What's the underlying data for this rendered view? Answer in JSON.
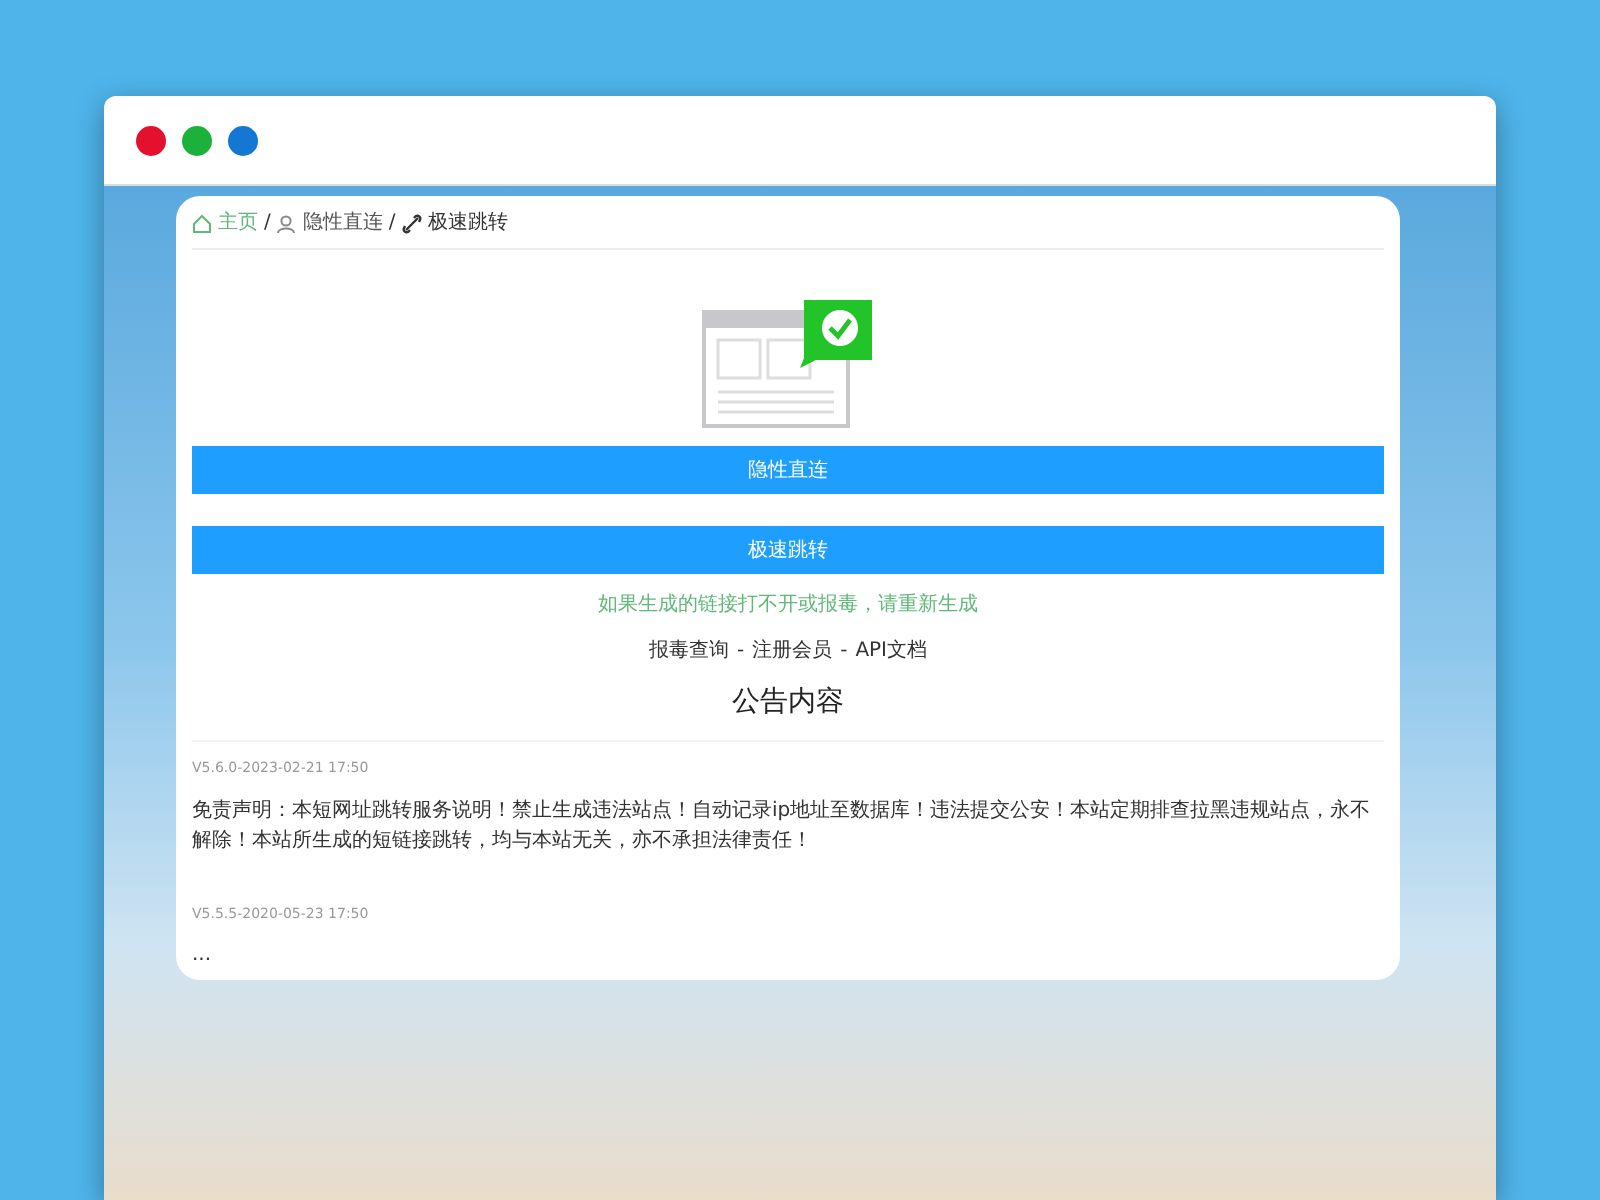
{
  "window": {
    "dots": [
      {
        "color": "#e4102e"
      },
      {
        "color": "#1cb13b"
      },
      {
        "color": "#1377d3"
      }
    ]
  },
  "breadcrumb": {
    "separator": "/",
    "items": [
      {
        "label": "主页",
        "kind": "home"
      },
      {
        "label": "隐性直连",
        "kind": "user"
      },
      {
        "label": "极速跳转",
        "kind": "link"
      }
    ]
  },
  "buttons": [
    "隐性直连",
    "极速跳转"
  ],
  "hint": "如果生成的链接打不开或报毒，请重新生成",
  "links": {
    "separator": "-",
    "items": [
      "报毒查询",
      "注册会员",
      "API文档"
    ]
  },
  "announcements": {
    "title": "公告内容",
    "posts": [
      {
        "meta": "V5.6.0-2023-02-21 17:50",
        "body": "免责声明：本短网址跳转服务说明！禁止生成违法站点！自动记录ip地址至数据库！违法提交公安！本站定期排查拉黑违规站点，永不解除！本站所生成的短链接跳转，均与本站无关，亦不承担法律责任！"
      },
      {
        "meta": "V5.5.5-2020-05-23 17:50",
        "body": "..."
      }
    ]
  }
}
